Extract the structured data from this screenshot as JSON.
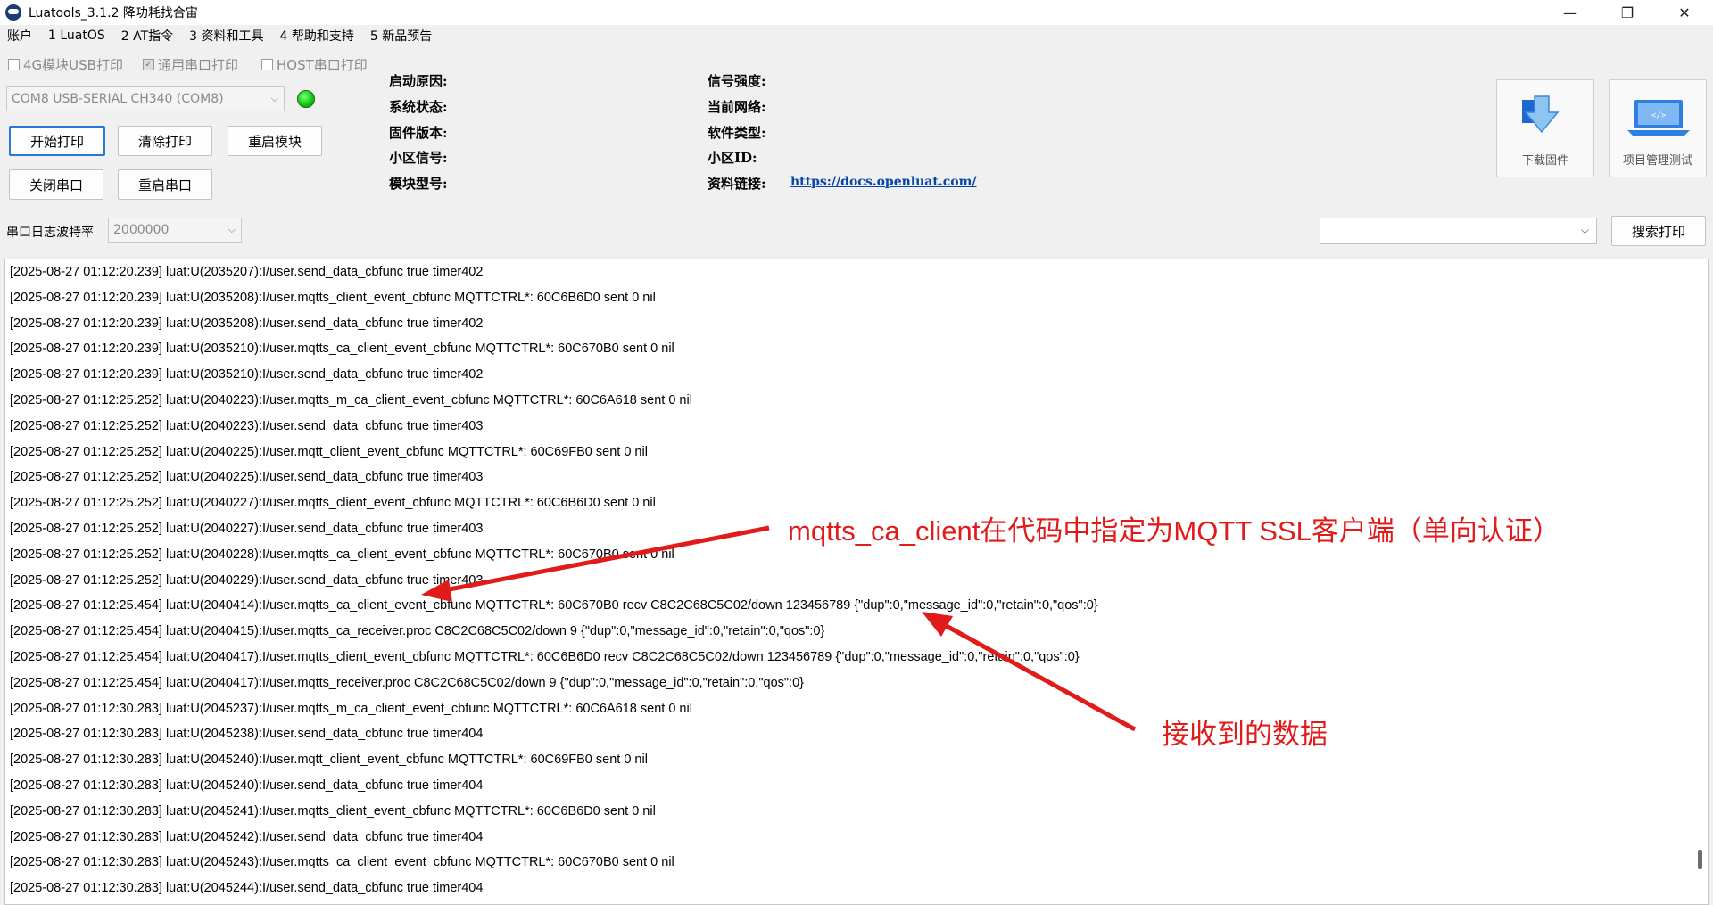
{
  "window": {
    "title": "Luatools_3.1.2 降功耗找合宙",
    "controls": {
      "minimize": "—",
      "restore": "❐",
      "close": "✕"
    }
  },
  "menu": [
    "账户",
    "1 LuatOS",
    "2 AT指令",
    "3 资料和工具",
    "4 帮助和支持",
    "5 新品预告"
  ],
  "checkboxes": [
    {
      "label": "4G模块USB打印",
      "checked": false
    },
    {
      "label": "通用串口打印",
      "checked": true
    },
    {
      "label": "HOST串口打印",
      "checked": false
    }
  ],
  "port_select": {
    "value": "COM8 USB-SERIAL CH340 (COM8)"
  },
  "buttons": {
    "start_print": "开始打印",
    "clear_print": "清除打印",
    "restart_module": "重启模块",
    "close_port": "关闭串口",
    "restart_port": "重启串口",
    "search_print": "搜索打印"
  },
  "info": {
    "boot_reason": "启动原因:",
    "system_status": "系统状态:",
    "firmware_version": "固件版本:",
    "cell_signal": "小区信号:",
    "module_model": "模块型号:",
    "signal_strength": "信号强度:",
    "current_network": "当前网络:",
    "software_type": "软件类型:",
    "cell_id": "小区ID:",
    "resource_link_label": "资料链接:",
    "resource_link": "https://docs.openluat.com/"
  },
  "tools": {
    "download_firmware": "下载固件",
    "project_test": "项目管理测试"
  },
  "baud": {
    "label": "串口日志波特率",
    "value": "2000000"
  },
  "log_lines": [
    "[2025-08-27 01:12:20.239] luat:U(2035207):I/user.send_data_cbfunc true timer402",
    "[2025-08-27 01:12:20.239] luat:U(2035208):I/user.mqtts_client_event_cbfunc MQTTCTRL*: 60C6B6D0 sent 0 nil",
    "[2025-08-27 01:12:20.239] luat:U(2035208):I/user.send_data_cbfunc true timer402",
    "[2025-08-27 01:12:20.239] luat:U(2035210):I/user.mqtts_ca_client_event_cbfunc MQTTCTRL*: 60C670B0 sent 0 nil",
    "[2025-08-27 01:12:20.239] luat:U(2035210):I/user.send_data_cbfunc true timer402",
    "[2025-08-27 01:12:25.252] luat:U(2040223):I/user.mqtts_m_ca_client_event_cbfunc MQTTCTRL*: 60C6A618 sent 0 nil",
    "[2025-08-27 01:12:25.252] luat:U(2040223):I/user.send_data_cbfunc true timer403",
    "[2025-08-27 01:12:25.252] luat:U(2040225):I/user.mqtt_client_event_cbfunc MQTTCTRL*: 60C69FB0 sent 0 nil",
    "[2025-08-27 01:12:25.252] luat:U(2040225):I/user.send_data_cbfunc true timer403",
    "[2025-08-27 01:12:25.252] luat:U(2040227):I/user.mqtts_client_event_cbfunc MQTTCTRL*: 60C6B6D0 sent 0 nil",
    "[2025-08-27 01:12:25.252] luat:U(2040227):I/user.send_data_cbfunc true timer403",
    "[2025-08-27 01:12:25.252] luat:U(2040228):I/user.mqtts_ca_client_event_cbfunc MQTTCTRL*: 60C670B0 sent 0 nil",
    "[2025-08-27 01:12:25.252] luat:U(2040229):I/user.send_data_cbfunc true timer403",
    "[2025-08-27 01:12:25.454] luat:U(2040414):I/user.mqtts_ca_client_event_cbfunc MQTTCTRL*: 60C670B0 recv C8C2C68C5C02/down 123456789 {\"dup\":0,\"message_id\":0,\"retain\":0,\"qos\":0}",
    "[2025-08-27 01:12:25.454] luat:U(2040415):I/user.mqtts_ca_receiver.proc C8C2C68C5C02/down 9 {\"dup\":0,\"message_id\":0,\"retain\":0,\"qos\":0}",
    "[2025-08-27 01:12:25.454] luat:U(2040417):I/user.mqtts_client_event_cbfunc MQTTCTRL*: 60C6B6D0 recv C8C2C68C5C02/down 123456789 {\"dup\":0,\"message_id\":0,\"retain\":0,\"qos\":0}",
    "[2025-08-27 01:12:25.454] luat:U(2040417):I/user.mqtts_receiver.proc C8C2C68C5C02/down 9 {\"dup\":0,\"message_id\":0,\"retain\":0,\"qos\":0}",
    "[2025-08-27 01:12:30.283] luat:U(2045237):I/user.mqtts_m_ca_client_event_cbfunc MQTTCTRL*: 60C6A618 sent 0 nil",
    "[2025-08-27 01:12:30.283] luat:U(2045238):I/user.send_data_cbfunc true timer404",
    "[2025-08-27 01:12:30.283] luat:U(2045240):I/user.mqtt_client_event_cbfunc MQTTCTRL*: 60C69FB0 sent 0 nil",
    "[2025-08-27 01:12:30.283] luat:U(2045240):I/user.send_data_cbfunc true timer404",
    "[2025-08-27 01:12:30.283] luat:U(2045241):I/user.mqtts_client_event_cbfunc MQTTCTRL*: 60C6B6D0 sent 0 nil",
    "[2025-08-27 01:12:30.283] luat:U(2045242):I/user.send_data_cbfunc true timer404",
    "[2025-08-27 01:12:30.283] luat:U(2045243):I/user.mqtts_ca_client_event_cbfunc MQTTCTRL*: 60C670B0 sent 0 nil",
    "[2025-08-27 01:12:30.283] luat:U(2045244):I/user.send_data_cbfunc true timer404"
  ],
  "annotations": {
    "ssl_client_note": "mqtts_ca_client在代码中指定为MQTT SSL客户端（单向认证）",
    "received_data_note": "接收到的数据",
    "color": "#e11a1a"
  },
  "icons": [
    "app-logo-icon",
    "download-arrow-icon",
    "laptop-code-icon",
    "chevron-down-icon",
    "status-led-icon"
  ]
}
